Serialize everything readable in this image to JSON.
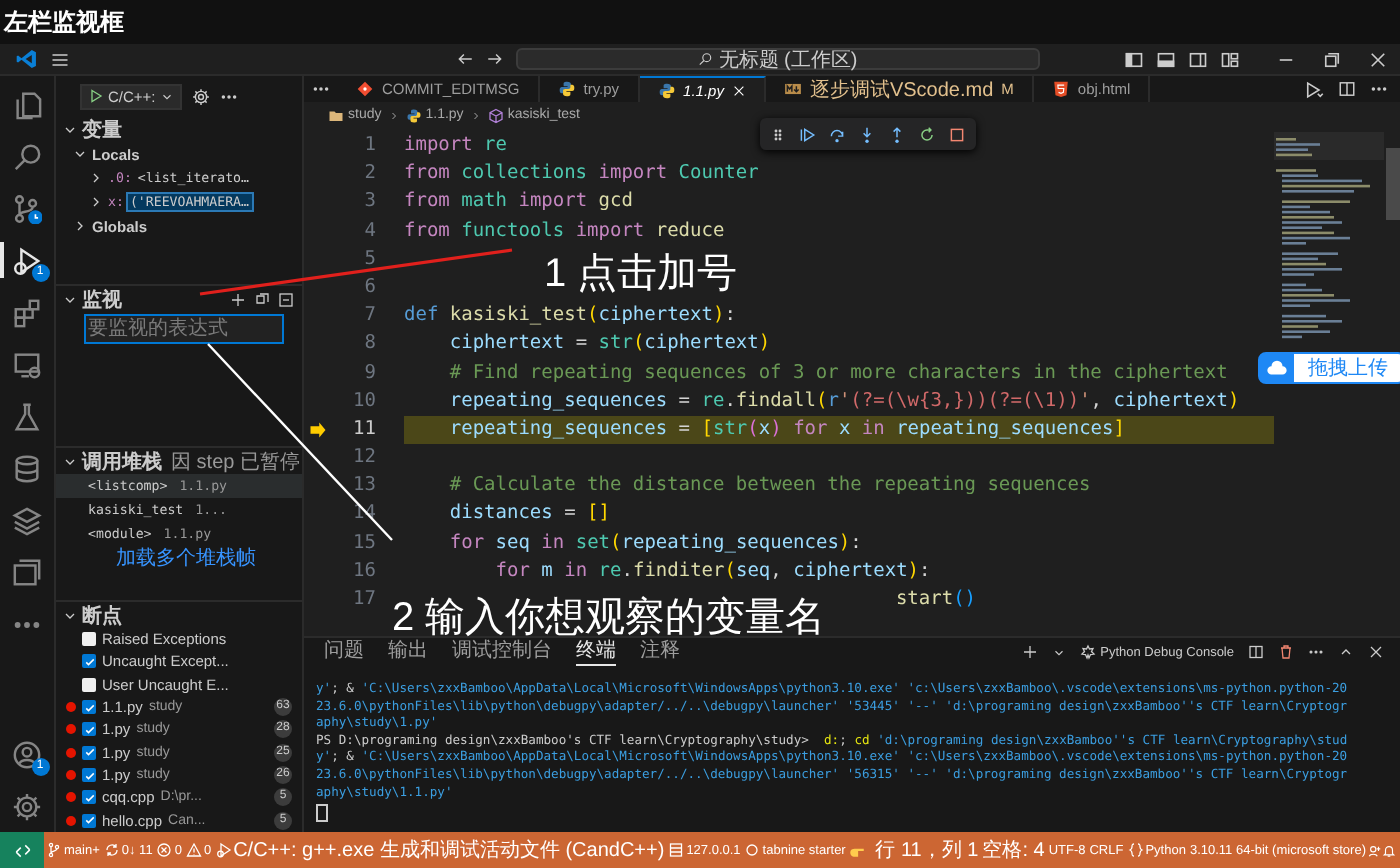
{
  "caption": "左栏监视框",
  "title_bar": {
    "search": "无标题 (工作区)"
  },
  "activity_bar": [
    {
      "selected": false
    },
    {
      "selected": false
    },
    {
      "selected": false
    },
    {
      "selected": true,
      "badge": "1"
    },
    {
      "selected": false
    },
    {
      "selected": false
    },
    {
      "selected": false
    },
    {
      "selected": false
    },
    {
      "selected": false
    },
    {
      "selected": false
    },
    {
      "selected": false
    },
    {
      "selected": false,
      "badge": "1"
    },
    {
      "selected": false
    }
  ],
  "run_bar": {
    "configuration": "C/C++:"
  },
  "variables": {
    "title": "变量",
    "expanded": true,
    "scopes": [
      {
        "name": "Locals",
        "expanded": true,
        "children": [
          {
            "name": ".0:",
            "value": "<list_iterato…",
            "expanded": false,
            "selected": false
          },
          {
            "name": "x:",
            "value": "('REEVOAHMAERA…",
            "expanded": false,
            "selected": true
          }
        ]
      },
      {
        "name": "Globals",
        "expanded": false
      }
    ]
  },
  "watch": {
    "title": "监视",
    "expanded": true,
    "placeholder": "要监视的表达式"
  },
  "call_stack": {
    "title": "调用堆栈",
    "expanded": true,
    "status": "因 step 已暂停",
    "frames": [
      {
        "name": "<listcomp>",
        "file": "1.1.py",
        "selected": true
      },
      {
        "name": "kasiski_test",
        "file": "1...",
        "selected": false
      },
      {
        "name": "<module>",
        "file": "1.1.py",
        "selected": false
      }
    ],
    "more": "加载多个堆栈帧"
  },
  "breakpoints": {
    "title": "断点",
    "expanded": true,
    "items": [
      {
        "kind": "exception",
        "label": "Raised Exceptions",
        "checked": false
      },
      {
        "kind": "exception",
        "label": "Uncaught Except...",
        "checked": true
      },
      {
        "kind": "exception",
        "label": "User Uncaught E...",
        "checked": false
      },
      {
        "kind": "file",
        "label": "1.1.py",
        "path": "study",
        "line": "63",
        "checked": true
      },
      {
        "kind": "file",
        "label": "1.py",
        "path": "study",
        "line": "28",
        "checked": true
      },
      {
        "kind": "file",
        "label": "1.py",
        "path": "study",
        "line": "25",
        "checked": true
      },
      {
        "kind": "file",
        "label": "1.py",
        "path": "study",
        "line": "26",
        "checked": true
      },
      {
        "kind": "file",
        "label": "cqq.cpp",
        "path": "D:\\pr...",
        "line": "5",
        "checked": true
      },
      {
        "kind": "file",
        "label": "hello.cpp",
        "path": "Can...",
        "line": "5",
        "checked": true
      }
    ]
  },
  "editor": {
    "tabs": [
      {
        "label": "COMMIT_EDITMSG",
        "selected": false,
        "preview": false
      },
      {
        "label": "try.py",
        "selected": false,
        "preview": false
      },
      {
        "label": "1.1.py",
        "selected": true,
        "preview": true
      },
      {
        "label": "逐步调试VScode.md",
        "selected": false,
        "preview": false,
        "badge": "M"
      },
      {
        "label": "obj.html",
        "selected": false,
        "preview": false
      }
    ],
    "breadcrumbs": [
      "study",
      "1.1.py",
      "kasiski_test"
    ],
    "lines": [
      {
        "number": "1",
        "current": false,
        "tokens": [
          {
            "kind": "kw",
            "text": "import "
          },
          {
            "kind": "mod",
            "text": "re"
          }
        ]
      },
      {
        "number": "2",
        "current": false,
        "tokens": [
          {
            "kind": "kw",
            "text": "from "
          },
          {
            "kind": "mod",
            "text": "collections "
          },
          {
            "kind": "kw",
            "text": "import "
          },
          {
            "kind": "mod",
            "text": "Counter"
          }
        ]
      },
      {
        "number": "3",
        "current": false,
        "tokens": [
          {
            "kind": "kw",
            "text": "from "
          },
          {
            "kind": "mod",
            "text": "math "
          },
          {
            "kind": "kw",
            "text": "import "
          },
          {
            "kind": "fn",
            "text": "gcd"
          }
        ]
      },
      {
        "number": "4",
        "current": false,
        "tokens": [
          {
            "kind": "kw",
            "text": "from "
          },
          {
            "kind": "mod",
            "text": "functools "
          },
          {
            "kind": "kw",
            "text": "import "
          },
          {
            "kind": "fn",
            "text": "reduce"
          }
        ]
      },
      {
        "number": "5",
        "current": false
      },
      {
        "number": "6",
        "current": false
      },
      {
        "number": "7",
        "current": false,
        "tokens": [
          {
            "kind": "def",
            "text": "def "
          },
          {
            "kind": "fn",
            "text": "kasiski_test"
          },
          {
            "kind": "p1",
            "text": "("
          },
          {
            "kind": "var",
            "text": "ciphertext"
          },
          {
            "kind": "p1",
            "text": ")"
          },
          {
            "kind": "op",
            "text": ":"
          }
        ]
      },
      {
        "number": "8",
        "current": false,
        "tokens": [
          {
            "kind": "var",
            "text": "    ciphertext"
          },
          {
            "kind": "op",
            "text": " = "
          },
          {
            "kind": "mod",
            "text": "str"
          },
          {
            "kind": "p1",
            "text": "("
          },
          {
            "kind": "var",
            "text": "ciphertext"
          },
          {
            "kind": "p1",
            "text": ")"
          }
        ]
      },
      {
        "number": "9",
        "current": false,
        "tokens": [
          {
            "kind": "cm",
            "text": "    # Find repeating sequences of 3 or more characters in the ciphertext"
          }
        ]
      },
      {
        "number": "10",
        "current": false,
        "tokens": [
          {
            "kind": "var",
            "text": "    repeating_sequences"
          },
          {
            "kind": "op",
            "text": " = "
          },
          {
            "kind": "mod",
            "text": "re"
          },
          {
            "kind": "op",
            "text": "."
          },
          {
            "kind": "fn",
            "text": "findall"
          },
          {
            "kind": "p1",
            "text": "("
          },
          {
            "kind": "def",
            "text": "r"
          },
          {
            "kind": "str",
            "text": "'"
          },
          {
            "kind": "regex",
            "text": "(?=(\\w{3,}))(?=(\\1))"
          },
          {
            "kind": "str",
            "text": "'"
          },
          {
            "kind": "op",
            "text": ", "
          },
          {
            "kind": "var",
            "text": "ciphertext"
          },
          {
            "kind": "p1",
            "text": ")"
          }
        ]
      },
      {
        "number": "11",
        "current": true,
        "tokens": [
          {
            "kind": "var",
            "text": "    repeating_sequences"
          },
          {
            "kind": "op",
            "text": " = "
          },
          {
            "kind": "p1",
            "text": "["
          },
          {
            "kind": "mod",
            "text": "str"
          },
          {
            "kind": "p2",
            "text": "("
          },
          {
            "kind": "var",
            "text": "x"
          },
          {
            "kind": "p2",
            "text": ")"
          },
          {
            "kind": "kw",
            "text": " for "
          },
          {
            "kind": "var",
            "text": "x"
          },
          {
            "kind": "kw",
            "text": " in "
          },
          {
            "kind": "var",
            "text": "repeating_sequences"
          },
          {
            "kind": "p1",
            "text": "]"
          }
        ]
      },
      {
        "number": "12",
        "current": false
      },
      {
        "number": "13",
        "current": false,
        "tokens": [
          {
            "kind": "cm",
            "text": "    # Calculate the distance between the repeating sequences"
          }
        ]
      },
      {
        "number": "14",
        "current": false,
        "tokens": [
          {
            "kind": "var",
            "text": "    distances"
          },
          {
            "kind": "op",
            "text": " = "
          },
          {
            "kind": "p1",
            "text": "[]"
          }
        ]
      },
      {
        "number": "15",
        "current": false,
        "tokens": [
          {
            "kind": "kw",
            "text": "    for "
          },
          {
            "kind": "var",
            "text": "seq"
          },
          {
            "kind": "kw",
            "text": " in "
          },
          {
            "kind": "mod",
            "text": "set"
          },
          {
            "kind": "p1",
            "text": "("
          },
          {
            "kind": "var",
            "text": "repeating_sequences"
          },
          {
            "kind": "p1",
            "text": ")"
          },
          {
            "kind": "op",
            "text": ":"
          }
        ]
      },
      {
        "number": "16",
        "current": false,
        "tokens": [
          {
            "kind": "kw",
            "text": "        for "
          },
          {
            "kind": "var",
            "text": "m"
          },
          {
            "kind": "kw",
            "text": " in "
          },
          {
            "kind": "mod",
            "text": "re"
          },
          {
            "kind": "op",
            "text": "."
          },
          {
            "kind": "fn",
            "text": "finditer"
          },
          {
            "kind": "p1",
            "text": "("
          },
          {
            "kind": "var",
            "text": "seq"
          },
          {
            "kind": "op",
            "text": ", "
          },
          {
            "kind": "var",
            "text": "ciphertext"
          },
          {
            "kind": "p1",
            "text": ")"
          },
          {
            "kind": "op",
            "text": ":"
          }
        ]
      },
      {
        "number": "17",
        "current": false,
        "tokens": [
          {
            "kind": "fn",
            "text": "                                           start"
          },
          {
            "kind": "p3",
            "text": "()"
          }
        ]
      }
    ],
    "upload_widget": "拖拽上传"
  },
  "panel": {
    "tabs": [
      {
        "label": "问题",
        "selected": false
      },
      {
        "label": "输出",
        "selected": false
      },
      {
        "label": "调试控制台",
        "selected": false
      },
      {
        "label": "终端",
        "selected": true
      },
      {
        "label": "注释",
        "selected": false
      }
    ],
    "terminal_name": "Python Debug Console",
    "lines": [
      [
        {
          "kind": "arg",
          "text": "y'"
        },
        {
          "kind": "plain",
          "text": "; & "
        },
        {
          "kind": "arg",
          "text": "'C:\\Users\\zxxBamboo\\AppData\\Local\\Microsoft\\WindowsApps\\python3.10.exe' 'c:\\Users\\zxxBamboo\\.vscode\\extensions\\ms-python.python-20"
        }
      ],
      [
        {
          "kind": "arg",
          "text": "23.6.0\\pythonFiles\\lib\\python\\debugpy\\adapter/../..\\debugpy\\launcher' '53445' '--' 'd:\\programing design\\zxxBamboo''s CTF learn\\Cryptogr"
        }
      ],
      [
        {
          "kind": "arg",
          "text": "aphy\\study\\1.py'"
        }
      ],
      [
        {
          "kind": "plain",
          "text": "PS D:\\programing design\\zxxBamboo's CTF learn\\Cryptography\\study>  "
        },
        {
          "kind": "cmd",
          "text": "d:"
        },
        {
          "kind": "plain",
          "text": "; "
        },
        {
          "kind": "cmd",
          "text": "cd"
        },
        {
          "kind": "arg",
          "text": " 'd:\\programing design\\zxxBamboo''s CTF learn\\Cryptography\\stud"
        }
      ],
      [
        {
          "kind": "arg",
          "text": "y'"
        },
        {
          "kind": "plain",
          "text": "; & "
        },
        {
          "kind": "arg",
          "text": "'C:\\Users\\zxxBamboo\\AppData\\Local\\Microsoft\\WindowsApps\\python3.10.exe' 'c:\\Users\\zxxBamboo\\.vscode\\extensions\\ms-python.python-20"
        }
      ],
      [
        {
          "kind": "arg",
          "text": "23.6.0\\pythonFiles\\lib\\python\\debugpy\\adapter/../..\\debugpy\\launcher' '56315' '--' 'd:\\programing design\\zxxBamboo''s CTF learn\\Cryptogr"
        }
      ],
      [
        {
          "kind": "arg",
          "text": "aphy\\study\\1.1.py'"
        }
      ]
    ],
    "cursor": true
  },
  "status_bar": {
    "items": [
      {
        "kind": "branch",
        "text": "main+"
      },
      {
        "kind": "sync",
        "text": "0↓ 11"
      },
      {
        "kind": "errors",
        "text": "0"
      },
      {
        "kind": "warnings",
        "text": "0"
      },
      {
        "kind": "debug",
        "text": "C/C++: g++.exe 生成和调试活动文件 (CandC++)"
      },
      {
        "kind": "server",
        "text": "127.0.0.1"
      },
      {
        "kind": "tabnine",
        "text": "tabnine starter"
      },
      {
        "kind": "plain",
        "text": "行 11，列 1"
      },
      {
        "kind": "plain",
        "text": "空格: 4"
      },
      {
        "kind": "plain",
        "text": "UTF-8"
      },
      {
        "kind": "plain",
        "text": "CRLF"
      },
      {
        "kind": "python",
        "text": "Python"
      },
      {
        "kind": "plain",
        "text": "3.10.11 64-bit (microsoft store)"
      }
    ]
  },
  "annotations": [
    {
      "text": "1 点击加号"
    },
    {
      "text": "2 输入你想观察的变量名"
    }
  ]
}
